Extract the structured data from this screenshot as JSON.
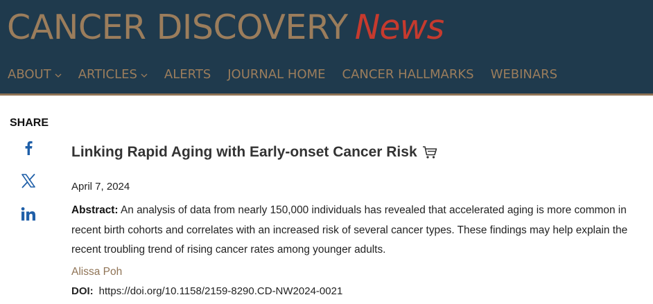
{
  "header": {
    "brand": "CANCER DISCOVERY",
    "brand_suffix": "News",
    "nav": [
      {
        "label": "ABOUT",
        "dropdown": true
      },
      {
        "label": "ARTICLES",
        "dropdown": true
      },
      {
        "label": "ALERTS",
        "dropdown": false
      },
      {
        "label": "JOURNAL HOME",
        "dropdown": false
      },
      {
        "label": "CANCER HALLMARKS",
        "dropdown": false
      },
      {
        "label": "WEBINARS",
        "dropdown": false
      }
    ]
  },
  "share": {
    "label": "SHARE",
    "icons": [
      "facebook-icon",
      "x-icon",
      "linkedin-icon"
    ]
  },
  "article": {
    "title": "Linking Rapid Aging with Early-onset Cancer Risk",
    "date": "April 7, 2024",
    "abstract_label": "Abstract:",
    "abstract_text": "An analysis of data from nearly 150,000 individuals has revealed that accelerated aging is more common in recent birth cohorts and correlates with an increased risk of several cancer types. These findings may help explain the recent troubling trend of rising cancer rates among younger adults.",
    "author": "Alissa Poh",
    "doi_label": "DOI:",
    "doi": "https://doi.org/10.1158/2159-8290.CD-NW2024-0021"
  },
  "colors": {
    "header_bg": "#1f3a4d",
    "brand": "#9b7d5c",
    "news": "#c63a2e",
    "social": "#1f5fa8"
  }
}
